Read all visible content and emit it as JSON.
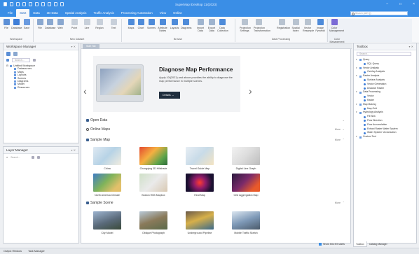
{
  "app": {
    "title": "SuperMap iDesktop 11i(2023)"
  },
  "menu": {
    "tabs": [
      "File",
      "Start",
      "Data",
      "3D Data",
      "Spatial Analysis",
      "Traffic Analysis",
      "Processing Automation",
      "View",
      "Online"
    ],
    "active": "Start",
    "search_placeholder": "Search (Alt+Q)"
  },
  "ribbon": {
    "buttons": [
      {
        "label": "File",
        "icon": "file-icon",
        "color": "#5b8fd6"
      },
      {
        "label": "Database",
        "icon": "database-icon",
        "color": "#3f7fd8"
      },
      {
        "label": "Save",
        "icon": "save-icon",
        "color": "#6a9be0"
      },
      {
        "label": "File",
        "icon": "file-open-icon",
        "color": "#8aa8d0"
      },
      {
        "label": "Database",
        "icon": "database-open-icon",
        "color": "#8aa8d0"
      },
      {
        "label": "Web",
        "icon": "web-icon",
        "color": "#8aa8d0"
      },
      {
        "label": "Point",
        "icon": "point-icon",
        "color": "#c8d0da"
      },
      {
        "label": "Line",
        "icon": "line-icon",
        "color": "#c8d0da"
      },
      {
        "label": "Region",
        "icon": "region-icon",
        "color": "#c8d0da"
      },
      {
        "label": "Text",
        "icon": "text-icon",
        "color": "#c8d0da"
      },
      {
        "label": "Maps",
        "icon": "maps-icon",
        "color": "#4e8bd9"
      },
      {
        "label": "Chart",
        "icon": "chart-icon",
        "color": "#4e8bd9"
      },
      {
        "label": "Scenes",
        "icon": "scenes-icon",
        "color": "#4e8bd9"
      },
      {
        "label": "Attribute Tables",
        "icon": "table-icon",
        "color": "#4e8bd9"
      },
      {
        "label": "Layouts",
        "icon": "layouts-icon",
        "color": "#4e8bd9"
      },
      {
        "label": "Diagrams",
        "icon": "diagrams-icon",
        "color": "#4e8bd9"
      },
      {
        "label": "Import Data",
        "icon": "import-icon",
        "color": "#9fb4cf"
      },
      {
        "label": "Export Data",
        "icon": "export-icon",
        "color": "#9fb4cf"
      },
      {
        "label": "Data Collection",
        "icon": "collection-icon",
        "color": "#4e8bd9"
      },
      {
        "label": "Projection Settings",
        "icon": "projection-icon",
        "color": "#b8c3d0"
      },
      {
        "label": "Projection Transformation",
        "icon": "transform-icon",
        "color": "#b8c3d0"
      },
      {
        "label": "Registration",
        "icon": "registration-icon",
        "color": "#b8c3d0"
      },
      {
        "label": "Spatial Index",
        "icon": "spatial-index-icon",
        "color": "#b8c3d0"
      },
      {
        "label": "Vector Resample",
        "icon": "resample-icon",
        "color": "#b8c3d0"
      },
      {
        "label": "Image Pyramid",
        "icon": "pyramid-icon",
        "color": "#4e8bd9"
      },
      {
        "label": "Color Management",
        "icon": "color-icon",
        "color": "#7a6bd6"
      }
    ],
    "groups": [
      "Workspace",
      "New Dataset",
      "Browse",
      "Data Processing",
      "Color Management"
    ]
  },
  "workspace_manager": {
    "title": "Workspace Manager",
    "search_placeholder": "Search...",
    "tree": [
      {
        "label": "Untitled Workspace",
        "level": 0
      },
      {
        "label": "Datasources",
        "level": 1
      },
      {
        "label": "Maps",
        "level": 1
      },
      {
        "label": "Layouts",
        "level": 1
      },
      {
        "label": "Scenes",
        "level": 1
      },
      {
        "label": "Diagrams",
        "level": 1
      },
      {
        "label": "Model",
        "level": 1
      },
      {
        "label": "Resources",
        "level": 1
      }
    ]
  },
  "layer_manager": {
    "title": "Layer Manager",
    "search_placeholder": "Search..."
  },
  "center": {
    "tab": "Start Tab",
    "banner": {
      "title": "Diagnose Map Performance",
      "body": "Apply 10i(2021) and above provides the ability to diagnose the map performance in multiple scenes.",
      "button": "Details →"
    },
    "sections": {
      "open_data": "Open Data",
      "online_maps": "Online Maps",
      "sample_map": "Sample Map",
      "sample_scene": "Sample Scene",
      "more": "More"
    },
    "sample_maps": [
      {
        "label": "China",
        "img": "linear-gradient(135deg,#dfe9f2,#b7d3e6 50%,#f2ede0)"
      },
      {
        "label": "Chongqing 3D Hillshade",
        "img": "linear-gradient(135deg,#e34a2f,#f5b041 40%,#5aa34a 75%,#2f6b3a)"
      },
      {
        "label": "Travel Guide Map",
        "img": "linear-gradient(135deg,#e8eef4,#c8dbe8 50%,#f4e4c2)"
      },
      {
        "label": "Digital Line Graph",
        "img": "linear-gradient(135deg,#f2f2f2,#dcdcdc 50%,#bcbcbc)"
      },
      {
        "label": "North America Climate",
        "img": "linear-gradient(135deg,#3e7cc4,#7fb35a 45%,#e2c06a 80%)"
      },
      {
        "label": "Boston With Mapbox",
        "img": "linear-gradient(135deg,#cfe0c8,#eaeaea 50%,#d9c9b3)"
      },
      {
        "label": "Heat Map",
        "img": "radial-gradient(circle at 50% 50%,#ff3b30,#8e1b6a 35%,#1a1030 75%)"
      },
      {
        "label": "Grid Aggregation Map",
        "img": "linear-gradient(135deg,#2a1a3e,#7a2a6a 45%,#e85a2a 80%)"
      }
    ],
    "sample_scenes": [
      {
        "label": "City Model",
        "img": "linear-gradient(160deg,#9db4cf,#5a6a7a 55%,#3a4a3a)"
      },
      {
        "label": "Oblique Photograph",
        "img": "linear-gradient(160deg,#b8c9d8,#8a7a5a 50%,#5a6a4a)"
      },
      {
        "label": "Underground Pipeline",
        "img": "linear-gradient(160deg,#6a5a4a,#d7b04a 45%,#3a6a8a)"
      },
      {
        "label": "Mobile Traffic Sketch",
        "img": "linear-gradient(160deg,#dbe6f0,#7f9ab8 50%,#4a5a6a)"
      }
    ],
    "show_at_startup": "Show this if it starts"
  },
  "toolbox": {
    "title": "Toolbox",
    "search_placeholder": "Search...",
    "items": [
      {
        "label": "Query",
        "level": 0
      },
      {
        "label": "SQL Query",
        "level": 1
      },
      {
        "label": "Vector Analysis",
        "level": 0
      },
      {
        "label": "Overlay Analysis",
        "level": 1
      },
      {
        "label": "Raster Analysis",
        "level": 0
      },
      {
        "label": "Surface Analysis",
        "level": 1
      },
      {
        "label": "Vector Generation",
        "level": 1
      },
      {
        "label": "Distance Raster",
        "level": 1
      },
      {
        "label": "Data Processing",
        "level": 0
      },
      {
        "label": "Vector",
        "level": 1
      },
      {
        "label": "Raster",
        "level": 1
      },
      {
        "label": "Map Making",
        "level": 0
      },
      {
        "label": "Map Grid",
        "level": 1
      },
      {
        "label": "Hydrology Analysis",
        "level": 0
      },
      {
        "label": "Fill Sink",
        "level": 1
      },
      {
        "label": "Flow Direction",
        "level": 1
      },
      {
        "label": "Flow Accumulation",
        "level": 1
      },
      {
        "label": "Extract Raster Water System",
        "level": 1
      },
      {
        "label": "Water System Vectorization",
        "level": 1
      },
      {
        "label": "Custom Tool",
        "level": 0
      }
    ],
    "tabs": [
      "Toolbox",
      "Catalog Manager"
    ]
  },
  "status": {
    "items": [
      "Output Window",
      "Task Manager"
    ]
  }
}
